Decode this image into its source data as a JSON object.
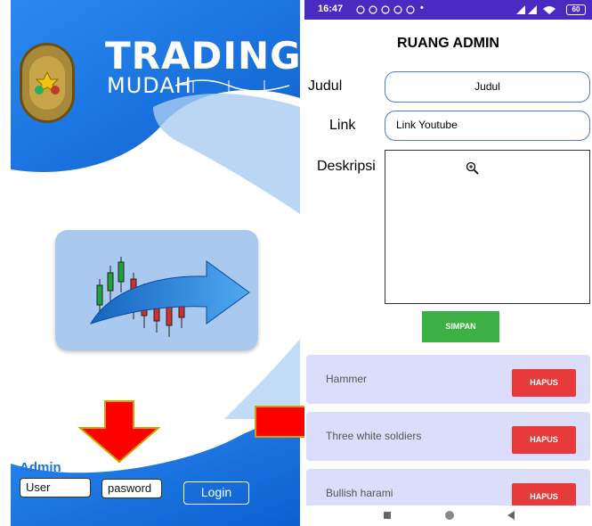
{
  "login_screen": {
    "brand_title": "TRADING",
    "brand_subtitle": "MUDAH",
    "admin_label": "Admin",
    "user_field": "User",
    "password_field": "pasword",
    "login_button": "Login"
  },
  "admin_screen": {
    "status_time": "16:47",
    "status_icons": "•",
    "status_battery": "60",
    "title": "RUANG ADMIN",
    "judul_label": "Judul",
    "judul_value": "Judul",
    "link_label": "Link",
    "link_value": "Link Youtube",
    "deskripsi_label": "Deskripsi",
    "save_button": "SIMPAN",
    "items": [
      {
        "name": "Hammer",
        "delete_label": "HAPUS"
      },
      {
        "name": "Three white soldiers",
        "delete_label": "HAPUS"
      },
      {
        "name": "Bullish harami",
        "delete_label": "HAPUS"
      }
    ]
  },
  "colors": {
    "login_blue": "#1e73e0",
    "status_purple": "#4a2bc2",
    "save_green": "#3cb043",
    "delete_red": "#e83a3a",
    "card_lavender": "#dcdcfb",
    "arrow_red": "#ff0000",
    "arrow_border": "#c8a400"
  }
}
